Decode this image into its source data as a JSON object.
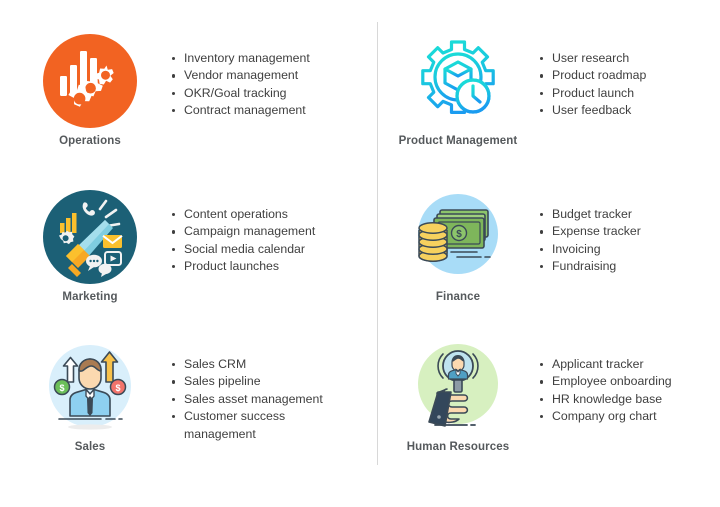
{
  "layout": {
    "divider": "vertical-rule",
    "columns": 2,
    "background_color": "#ffffff",
    "text_color": "#3f3f3f",
    "label_color": "#55595c"
  },
  "cards": [
    {
      "id": "operations",
      "label": "Operations",
      "icon": "operations-bar-chart-gears-icon",
      "icon_colors": {
        "circle": "#F26322",
        "glyph": "#ffffff"
      },
      "items": [
        "Inventory management",
        "Vendor management",
        "OKR/Goal tracking",
        "Contract management"
      ]
    },
    {
      "id": "marketing",
      "label": "Marketing",
      "icon": "marketing-megaphone-icon",
      "icon_colors": {
        "circle": "#1C6076",
        "megaphone": "#7FCDE0",
        "handle": "#F7A823",
        "accent": "#FBC02D"
      },
      "items": [
        "Content operations",
        "Campaign management",
        "Social media calendar",
        "Product launches"
      ]
    },
    {
      "id": "sales",
      "label": "Sales",
      "icon": "sales-businessman-arrows-icon",
      "icon_colors": {
        "circle": "#D6EEFB",
        "shirt": "#8ED0F0",
        "arrow": "#F7C14B",
        "coin_green": "#6BBF59",
        "coin_red": "#F2736B"
      },
      "items": [
        "Sales CRM",
        "Sales pipeline",
        "Sales asset management",
        "Customer success\nmanagement"
      ]
    },
    {
      "id": "product-management",
      "label": "Product Management",
      "icon": "product-gear-box-clock-icon",
      "icon_colors": {
        "stroke_top": "#1BD9D9",
        "stroke_bottom": "#1AA7EC"
      },
      "items": [
        "User research",
        "Product roadmap",
        "Product launch",
        "User feedback"
      ]
    },
    {
      "id": "finance",
      "label": "Finance",
      "icon": "finance-money-coins-icon",
      "icon_colors": {
        "circle": "#A8DCF7",
        "bill": "#7EB65B",
        "coin": "#F7D15E"
      },
      "items": [
        "Budget tracker",
        "Expense tracker",
        "Invoicing",
        "Fundraising"
      ]
    },
    {
      "id": "human-resources",
      "label": "Human Resources",
      "icon": "hr-hand-magnifier-person-icon",
      "icon_colors": {
        "circle": "#D7F0C0",
        "hand": "#FBD9B0",
        "sleeve": "#33475B",
        "lens": "#BFE3EF"
      },
      "items": [
        "Applicant tracker",
        "Employee onboarding",
        "HR knowledge base",
        "Company org chart"
      ]
    }
  ]
}
